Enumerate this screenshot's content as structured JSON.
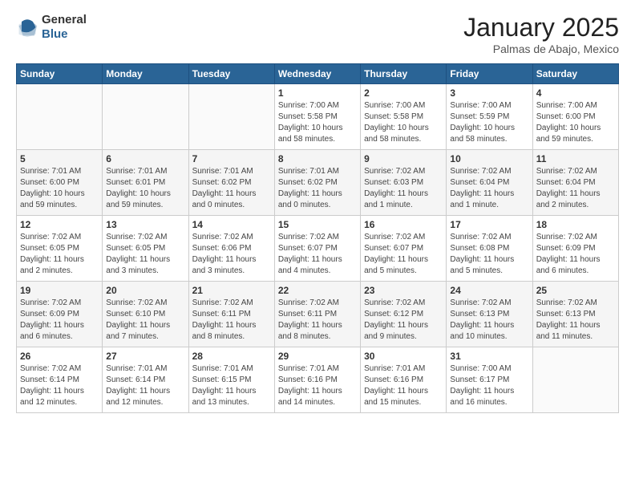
{
  "header": {
    "logo_line1": "General",
    "logo_line2": "Blue",
    "month": "January 2025",
    "location": "Palmas de Abajo, Mexico"
  },
  "weekdays": [
    "Sunday",
    "Monday",
    "Tuesday",
    "Wednesday",
    "Thursday",
    "Friday",
    "Saturday"
  ],
  "weeks": [
    [
      {
        "day": "",
        "info": ""
      },
      {
        "day": "",
        "info": ""
      },
      {
        "day": "",
        "info": ""
      },
      {
        "day": "1",
        "info": "Sunrise: 7:00 AM\nSunset: 5:58 PM\nDaylight: 10 hours\nand 58 minutes."
      },
      {
        "day": "2",
        "info": "Sunrise: 7:00 AM\nSunset: 5:58 PM\nDaylight: 10 hours\nand 58 minutes."
      },
      {
        "day": "3",
        "info": "Sunrise: 7:00 AM\nSunset: 5:59 PM\nDaylight: 10 hours\nand 58 minutes."
      },
      {
        "day": "4",
        "info": "Sunrise: 7:00 AM\nSunset: 6:00 PM\nDaylight: 10 hours\nand 59 minutes."
      }
    ],
    [
      {
        "day": "5",
        "info": "Sunrise: 7:01 AM\nSunset: 6:00 PM\nDaylight: 10 hours\nand 59 minutes."
      },
      {
        "day": "6",
        "info": "Sunrise: 7:01 AM\nSunset: 6:01 PM\nDaylight: 10 hours\nand 59 minutes."
      },
      {
        "day": "7",
        "info": "Sunrise: 7:01 AM\nSunset: 6:02 PM\nDaylight: 11 hours\nand 0 minutes."
      },
      {
        "day": "8",
        "info": "Sunrise: 7:01 AM\nSunset: 6:02 PM\nDaylight: 11 hours\nand 0 minutes."
      },
      {
        "day": "9",
        "info": "Sunrise: 7:02 AM\nSunset: 6:03 PM\nDaylight: 11 hours\nand 1 minute."
      },
      {
        "day": "10",
        "info": "Sunrise: 7:02 AM\nSunset: 6:04 PM\nDaylight: 11 hours\nand 1 minute."
      },
      {
        "day": "11",
        "info": "Sunrise: 7:02 AM\nSunset: 6:04 PM\nDaylight: 11 hours\nand 2 minutes."
      }
    ],
    [
      {
        "day": "12",
        "info": "Sunrise: 7:02 AM\nSunset: 6:05 PM\nDaylight: 11 hours\nand 2 minutes."
      },
      {
        "day": "13",
        "info": "Sunrise: 7:02 AM\nSunset: 6:05 PM\nDaylight: 11 hours\nand 3 minutes."
      },
      {
        "day": "14",
        "info": "Sunrise: 7:02 AM\nSunset: 6:06 PM\nDaylight: 11 hours\nand 3 minutes."
      },
      {
        "day": "15",
        "info": "Sunrise: 7:02 AM\nSunset: 6:07 PM\nDaylight: 11 hours\nand 4 minutes."
      },
      {
        "day": "16",
        "info": "Sunrise: 7:02 AM\nSunset: 6:07 PM\nDaylight: 11 hours\nand 5 minutes."
      },
      {
        "day": "17",
        "info": "Sunrise: 7:02 AM\nSunset: 6:08 PM\nDaylight: 11 hours\nand 5 minutes."
      },
      {
        "day": "18",
        "info": "Sunrise: 7:02 AM\nSunset: 6:09 PM\nDaylight: 11 hours\nand 6 minutes."
      }
    ],
    [
      {
        "day": "19",
        "info": "Sunrise: 7:02 AM\nSunset: 6:09 PM\nDaylight: 11 hours\nand 6 minutes."
      },
      {
        "day": "20",
        "info": "Sunrise: 7:02 AM\nSunset: 6:10 PM\nDaylight: 11 hours\nand 7 minutes."
      },
      {
        "day": "21",
        "info": "Sunrise: 7:02 AM\nSunset: 6:11 PM\nDaylight: 11 hours\nand 8 minutes."
      },
      {
        "day": "22",
        "info": "Sunrise: 7:02 AM\nSunset: 6:11 PM\nDaylight: 11 hours\nand 8 minutes."
      },
      {
        "day": "23",
        "info": "Sunrise: 7:02 AM\nSunset: 6:12 PM\nDaylight: 11 hours\nand 9 minutes."
      },
      {
        "day": "24",
        "info": "Sunrise: 7:02 AM\nSunset: 6:13 PM\nDaylight: 11 hours\nand 10 minutes."
      },
      {
        "day": "25",
        "info": "Sunrise: 7:02 AM\nSunset: 6:13 PM\nDaylight: 11 hours\nand 11 minutes."
      }
    ],
    [
      {
        "day": "26",
        "info": "Sunrise: 7:02 AM\nSunset: 6:14 PM\nDaylight: 11 hours\nand 12 minutes."
      },
      {
        "day": "27",
        "info": "Sunrise: 7:01 AM\nSunset: 6:14 PM\nDaylight: 11 hours\nand 12 minutes."
      },
      {
        "day": "28",
        "info": "Sunrise: 7:01 AM\nSunset: 6:15 PM\nDaylight: 11 hours\nand 13 minutes."
      },
      {
        "day": "29",
        "info": "Sunrise: 7:01 AM\nSunset: 6:16 PM\nDaylight: 11 hours\nand 14 minutes."
      },
      {
        "day": "30",
        "info": "Sunrise: 7:01 AM\nSunset: 6:16 PM\nDaylight: 11 hours\nand 15 minutes."
      },
      {
        "day": "31",
        "info": "Sunrise: 7:00 AM\nSunset: 6:17 PM\nDaylight: 11 hours\nand 16 minutes."
      },
      {
        "day": "",
        "info": ""
      }
    ]
  ]
}
